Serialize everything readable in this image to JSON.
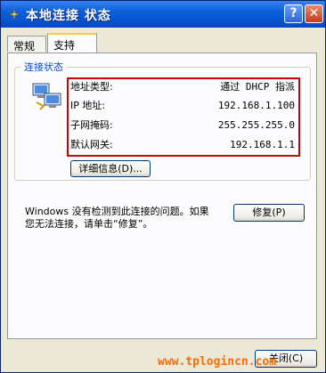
{
  "window": {
    "title": "本地连接 状态",
    "help_label": "?",
    "close_label": "✕"
  },
  "tabs": [
    {
      "label": "常规",
      "active": false
    },
    {
      "label": "支持",
      "active": true
    }
  ],
  "connection_status": {
    "group_title": "连接状态",
    "rows": [
      {
        "label": "地址类型:",
        "value": "通过 DHCP 指派"
      },
      {
        "label": "IP 地址:",
        "value": "192.168.1.100"
      },
      {
        "label": "子网掩码:",
        "value": "255.255.255.0"
      },
      {
        "label": "默认网关:",
        "value": "192.168.1.1"
      }
    ],
    "details_button": "详细信息(D)...",
    "highlight_color": "#cc0000"
  },
  "repair": {
    "message": "Windows 没有检测到此连接的问题。如果\n您无法连接，请单击“修复”。",
    "button": "修复(P)"
  },
  "footer": {
    "close_button": "关闭(C)"
  },
  "watermark": "www.tplogincn.com"
}
